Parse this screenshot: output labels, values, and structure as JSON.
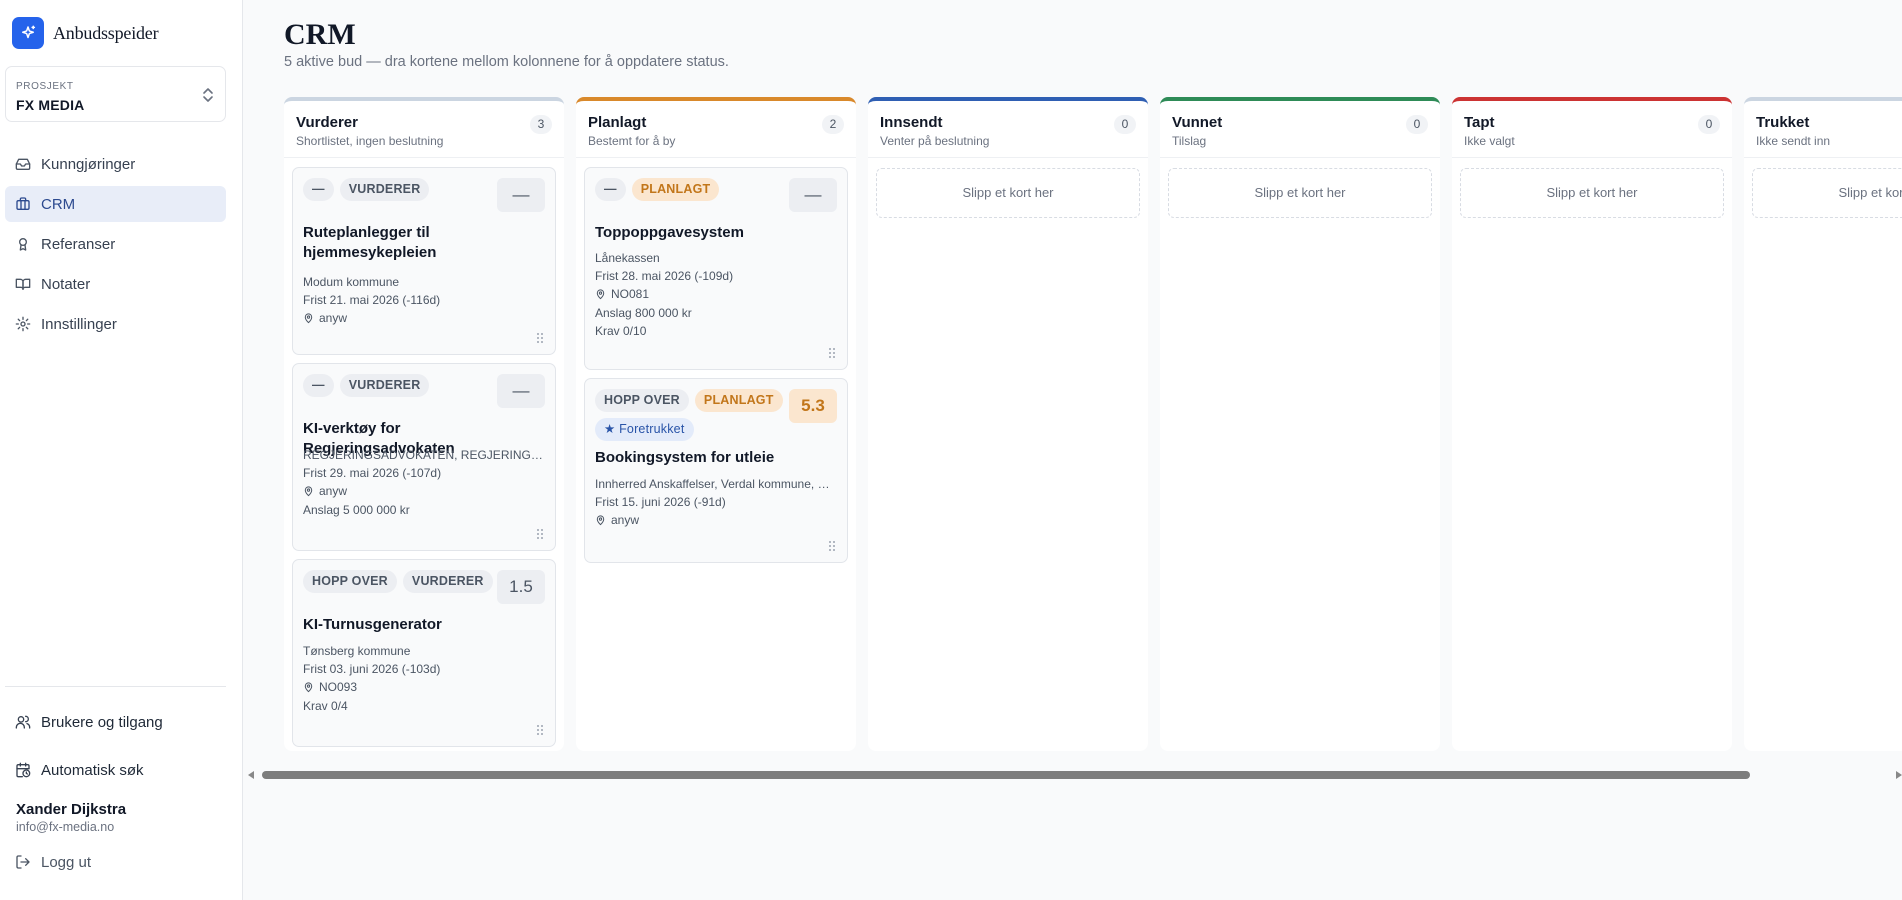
{
  "brand": {
    "name": "Anbudsspeider",
    "logo_icon": "sparkle-icon",
    "accent": "#2563eb"
  },
  "project": {
    "label": "PROSJEKT",
    "name": "FX MEDIA"
  },
  "nav": [
    {
      "label": "Kunngjøringer",
      "icon": "inbox-icon",
      "active": false
    },
    {
      "label": "CRM",
      "icon": "briefcase-icon",
      "active": true
    },
    {
      "label": "Referanser",
      "icon": "award-icon",
      "active": false
    },
    {
      "label": "Notater",
      "icon": "book-icon",
      "active": false
    },
    {
      "label": "Innstillinger",
      "icon": "gear-icon",
      "active": false
    }
  ],
  "bottom": {
    "users_label": "Brukere og tilgang",
    "autosearch_label": "Automatisk søk",
    "user_name": "Xander Dijkstra",
    "user_email": "info@fx-media.no",
    "logout_label": "Logg ut"
  },
  "page": {
    "title": "CRM",
    "subtitle": "5 aktive bud — dra kortene mellom kolonnene for å oppdatere status."
  },
  "drop_text": "Slipp et kort her",
  "columns": [
    {
      "name": "Vurderer",
      "desc": "Shortlistet, ingen beslutning",
      "count": "3",
      "color": "#cbd5e1"
    },
    {
      "name": "Planlagt",
      "desc": "Bestemt for å by",
      "count": "2",
      "color": "#d9892b"
    },
    {
      "name": "Innsendt",
      "desc": "Venter på beslutning",
      "count": "0",
      "color": "#2f5fb3"
    },
    {
      "name": "Vunnet",
      "desc": "Tilslag",
      "count": "0",
      "color": "#2e8b57"
    },
    {
      "name": "Tapt",
      "desc": "Ikke valgt",
      "count": "0",
      "color": "#cc3333"
    },
    {
      "name": "Trukket",
      "desc": "Ikke sendt inn",
      "count": "",
      "color": "#cbd5e1"
    }
  ],
  "cards": {
    "c1": {
      "tag1": "—",
      "tag2": "VURDERER",
      "score": "—",
      "title": "Ruteplanlegger til hjemmesykepleien",
      "buyer": "Modum kommune",
      "deadline": "Frist 21. mai 2026 (-116d)",
      "location": "anyw"
    },
    "c2": {
      "tag1": "—",
      "tag2": "VURDERER",
      "score": "—",
      "title": "KI-verktøy for Regjeringsadvokaten",
      "buyer": "REGJERINGSADVOKATEN, REGJERINGSADVOKATEN",
      "deadline": "Frist 29. mai 2026 (-107d)",
      "location": "anyw",
      "estimate": "Anslag 5 000 000 kr"
    },
    "c3": {
      "tag1": "HOPP OVER",
      "tag2": "VURDERER",
      "score": "1.5",
      "title": "KI-Turnusgenerator",
      "buyer": "Tønsberg kommune",
      "deadline": "Frist 03. juni 2026 (-103d)",
      "location": "NO093",
      "req": "Krav 0/4"
    },
    "c4": {
      "tag1": "—",
      "tag2": "PLANLAGT",
      "score": "—",
      "title": "Toppoppgavesystem",
      "buyer": "Lånekassen",
      "deadline": "Frist 28. mai 2026 (-109d)",
      "location": "NO081",
      "estimate": "Anslag 800 000 kr",
      "req": "Krav 0/10"
    },
    "c5": {
      "tag1": "HOPP OVER",
      "tag2": "PLANLAGT",
      "tag3": "★ Foretrukket",
      "score": "5.3",
      "title": "Bookingsystem for utleie",
      "buyer": "Innherred Anskaffelser, Verdal kommune, Røros kommune",
      "deadline": "Frist 15. juni 2026 (-91d)",
      "location": "anyw"
    }
  }
}
